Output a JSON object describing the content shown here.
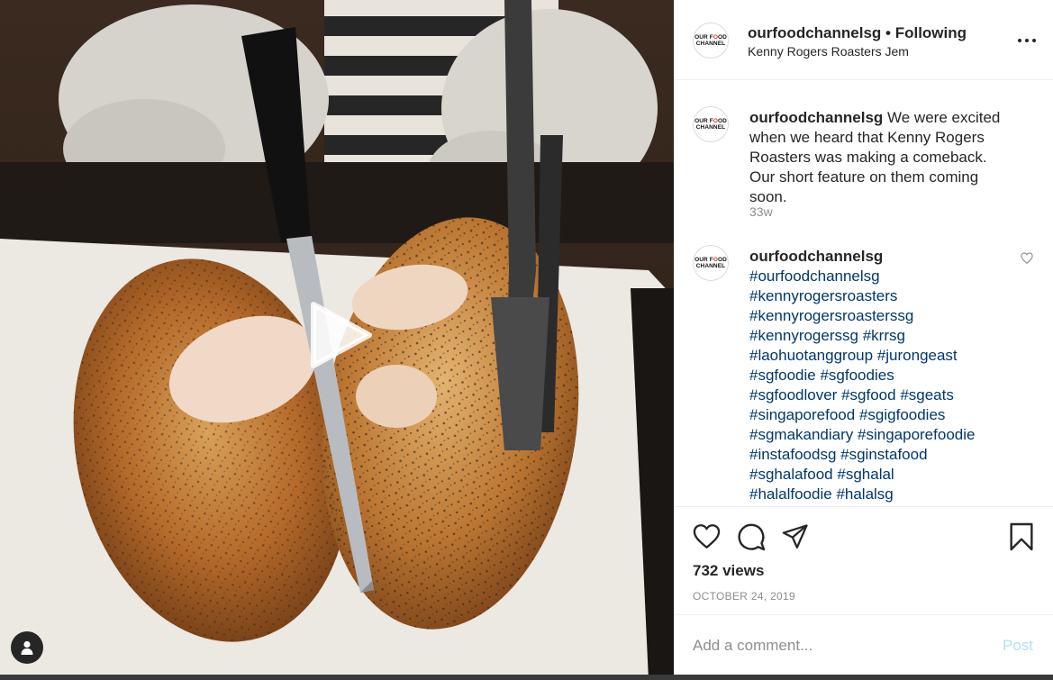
{
  "post": {
    "username": "ourfoodchannelsg",
    "separator": "•",
    "follow_status": "Following",
    "location": "Kenny Rogers Roasters Jem",
    "avatar_logo": {
      "line1_a": "OUR F",
      "line1_b": "O",
      "line1_c": "OD",
      "line2": "CHANNEL"
    }
  },
  "caption": {
    "username": "ourfoodchannelsg",
    "text": "We were excited when we heard that Kenny Rogers Roasters was making a comeback. Our short feature on them coming soon.",
    "time": "33w"
  },
  "hashtag_comment": {
    "username": "ourfoodchannelsg",
    "tags": [
      "#ourfoodchannelsg",
      "#kennyrogersroasters",
      "#kennyrogersroasterssg",
      "#kennyrogerssg",
      "#krrsg",
      "#laohuotanggroup",
      "#jurongeast",
      "#sgfoodie",
      "#sgfoodies",
      "#sgfoodlover",
      "#sgfood",
      "#sgeats",
      "#singaporefood",
      "#sgigfoodies",
      "#sgmakandiary",
      "#singaporefoodie",
      "#instafoodsg",
      "#sginstafood",
      "#sghalafood",
      "#sghalal",
      "#halalfoodie",
      "#halalsg"
    ],
    "lines": [
      [
        0
      ],
      [
        1
      ],
      [
        2
      ],
      [
        3,
        4
      ],
      [
        5,
        6
      ],
      [
        7,
        8
      ],
      [
        9,
        10,
        11
      ],
      [
        12,
        13
      ],
      [
        14,
        15
      ],
      [
        16,
        17
      ],
      [
        18,
        19
      ],
      [
        20,
        21
      ]
    ]
  },
  "stats": {
    "views": "732 views",
    "date": "OCTOBER 24, 2019"
  },
  "add_comment": {
    "placeholder": "Add a comment...",
    "post_label": "Post"
  },
  "icons": {
    "like": "heart-icon",
    "comment": "speech-bubble-icon",
    "share": "paper-plane-icon",
    "save": "bookmark-icon",
    "more": "ellipsis-icon",
    "play": "play-icon",
    "tagged_user": "user-icon"
  },
  "colors": {
    "hashtag": "#00376b",
    "secondary_text": "#8e8e8e",
    "post_disabled": "#b2dffc",
    "logo_accent": "#e0332b"
  }
}
